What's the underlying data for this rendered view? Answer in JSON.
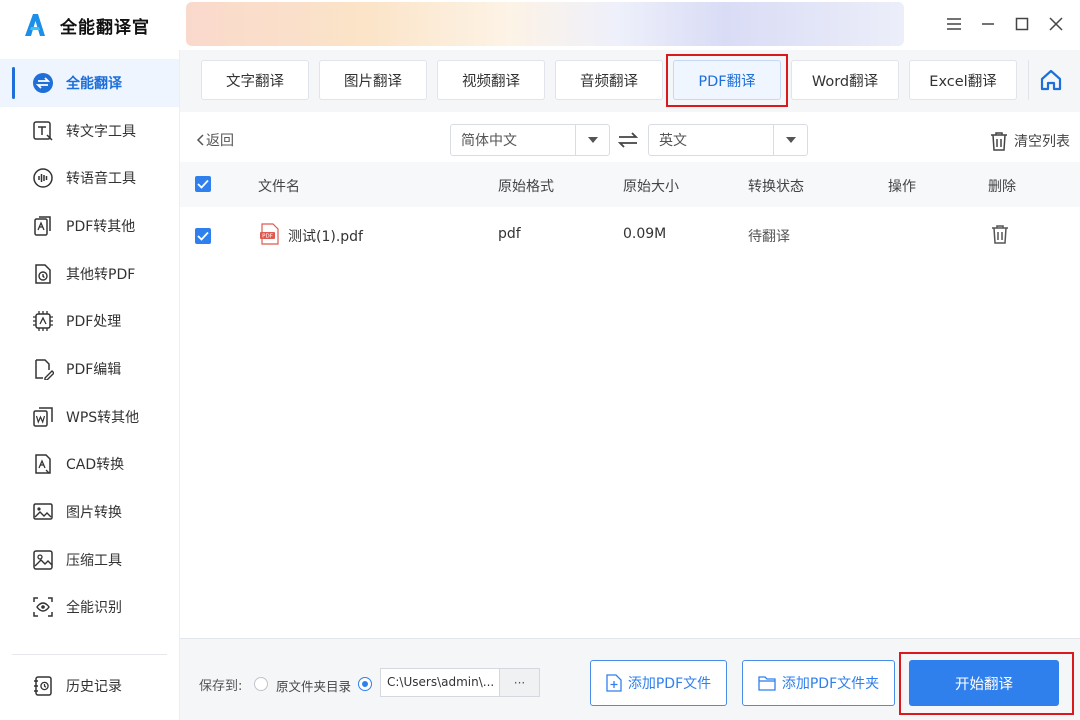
{
  "app": {
    "title": "全能翻译官"
  },
  "window": {
    "controls": [
      "menu-icon",
      "minimize-icon",
      "maximize-icon",
      "close-icon"
    ]
  },
  "sidebar": {
    "items": [
      {
        "label": "全能翻译",
        "icon": "translate-icon",
        "active": true
      },
      {
        "label": "转文字工具",
        "icon": "text-convert-icon"
      },
      {
        "label": "转语音工具",
        "icon": "voice-icon"
      },
      {
        "label": "PDF转其他",
        "icon": "pdf-convert-icon"
      },
      {
        "label": "其他转PDF",
        "icon": "to-pdf-icon"
      },
      {
        "label": "PDF处理",
        "icon": "pdf-process-icon"
      },
      {
        "label": "PDF编辑",
        "icon": "pdf-edit-icon"
      },
      {
        "label": "WPS转其他",
        "icon": "wps-icon"
      },
      {
        "label": "CAD转换",
        "icon": "cad-icon"
      },
      {
        "label": "图片转换",
        "icon": "image-convert-icon"
      },
      {
        "label": "压缩工具",
        "icon": "compress-icon"
      },
      {
        "label": "全能识别",
        "icon": "recognize-icon"
      }
    ],
    "history": {
      "label": "历史记录",
      "icon": "history-icon"
    }
  },
  "tabs": [
    "文字翻译",
    "图片翻译",
    "视频翻译",
    "音频翻译",
    "PDF翻译",
    "Word翻译",
    "Excel翻译"
  ],
  "active_tab": "PDF翻译",
  "toolbar": {
    "back": "返回",
    "source_lang": "简体中文",
    "target_lang": "英文",
    "clear": "清空列表"
  },
  "table": {
    "headers": [
      "文件名",
      "原始格式",
      "原始大小",
      "转换状态",
      "操作",
      "删除"
    ],
    "rows": [
      {
        "name": "测试(1).pdf",
        "format": "pdf",
        "size": "0.09M",
        "status": "待翻译",
        "checked": true
      }
    ]
  },
  "bottom": {
    "save_to": "保存到:",
    "option_source": "原文件夹目录",
    "path": "C:\\Users\\admin\\...",
    "browse": "···",
    "add_file": "添加PDF文件",
    "add_folder": "添加PDF文件夹",
    "start": "开始翻译"
  },
  "colors": {
    "accent": "#2f80ed",
    "highlight": "#d9191c"
  }
}
